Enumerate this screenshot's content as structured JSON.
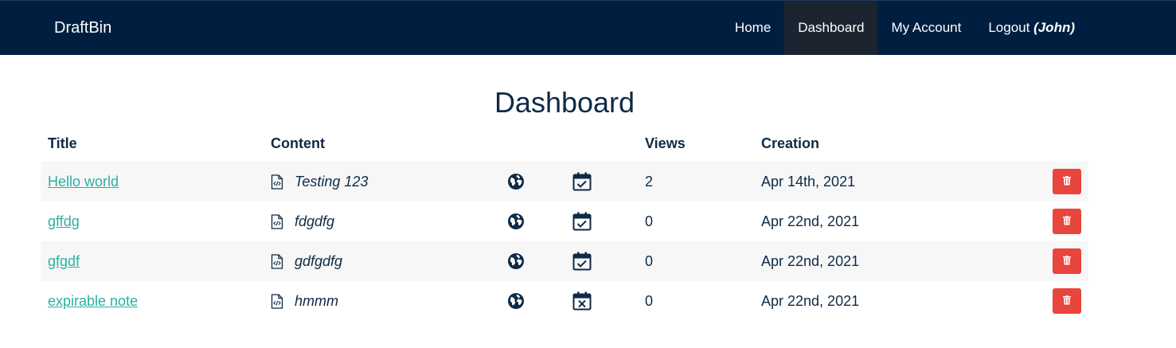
{
  "nav": {
    "brand": "DraftBin",
    "links": [
      {
        "label": "Home"
      },
      {
        "label": "Dashboard"
      },
      {
        "label": "My Account"
      },
      {
        "label": "Logout",
        "user": "(John)"
      }
    ]
  },
  "page": {
    "title": "Dashboard"
  },
  "table": {
    "headers": {
      "title": "Title",
      "content": "Content",
      "views": "Views",
      "creation": "Creation"
    },
    "rows": [
      {
        "title": "Hello world",
        "content": "Testing 123",
        "visibility_icon": "globe-icon",
        "expiry_icon": "calendar-check-icon",
        "views": "2",
        "creation": "Apr 14th, 2021"
      },
      {
        "title": "gffdg",
        "content": "fdgdfg",
        "visibility_icon": "globe-icon",
        "expiry_icon": "calendar-check-icon",
        "views": "0",
        "creation": "Apr 22nd, 2021"
      },
      {
        "title": "gfgdf",
        "content": "gdfgdfg",
        "visibility_icon": "globe-icon",
        "expiry_icon": "calendar-check-icon",
        "views": "0",
        "creation": "Apr 22nd, 2021"
      },
      {
        "title": "expirable note",
        "content": "hmmm",
        "visibility_icon": "globe-icon",
        "expiry_icon": "calendar-x-icon",
        "views": "0",
        "creation": "Apr 22nd, 2021"
      }
    ]
  },
  "colors": {
    "navbar": "#001f40",
    "active_nav": "#1c2430",
    "link": "#2bb0a0",
    "delete": "#e8453c",
    "stripe": "#f7f7f7"
  }
}
